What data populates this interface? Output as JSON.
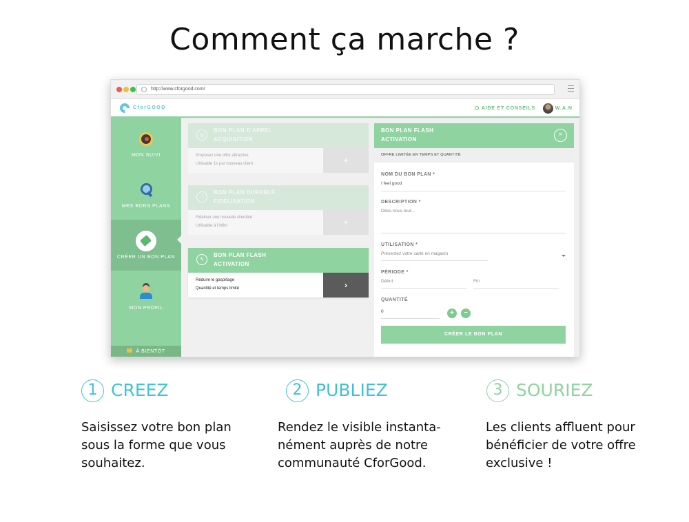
{
  "page": {
    "title": "Comment ça marche ?"
  },
  "browser": {
    "url": "http://www.cforgood.com/"
  },
  "app": {
    "logo_text": "CforGOOD",
    "help_label": "AIDE ET CONSEILS",
    "user_name": "W.A.N"
  },
  "sidebar": {
    "items": [
      {
        "label": "MON SUIVI",
        "icon": "gauge-icon"
      },
      {
        "label": "MES BONS PLANS",
        "icon": "search-icon"
      },
      {
        "label": "CRÉER UN BON PLAN",
        "icon": "tag-icon"
      },
      {
        "label": "MON PROFIL",
        "icon": "user-icon"
      }
    ],
    "footer": "À BIENTÔT"
  },
  "cards": [
    {
      "title": "BON PLAN D'APPEL",
      "subtitle": "ACQUISITION",
      "line1": "Proposez une offre attractive",
      "line2": "Utilisable 1x par nouveau client",
      "button": "+"
    },
    {
      "title": "BON PLAN DURABLE",
      "subtitle": "FIDÉLISATION",
      "line1": "Fidéliser une nouvelle clientèle",
      "line2": "Utilisable à l'infini",
      "button": "+"
    },
    {
      "title": "BON PLAN FLASH",
      "subtitle": "ACTIVATION",
      "line1": "Réduire le gaspillage",
      "line2": "Quantité et temps limité",
      "button": "›"
    }
  ],
  "panel": {
    "title": "BON PLAN FLASH",
    "subtitle": "ACTIVATION",
    "close": "×",
    "note": "OFFRE LIMITÉE EN TEMPS ET QUANTITÉ",
    "name_label": "NOM DU BON PLAN *",
    "name_value": "I feel good",
    "desc_label": "DESCRIPTION *",
    "desc_placeholder": "Dites-nous tout...",
    "usage_label": "UTILISATION *",
    "usage_value": "Présentez votre carte en magasin",
    "period_label": "PÉRIODE *",
    "period_start": "Début",
    "period_end": "Fin",
    "qty_label": "QUANTITÉ",
    "qty_value": "0",
    "plus": "+",
    "minus": "−",
    "submit": "CRÉER LE BON PLAN"
  },
  "steps": [
    {
      "num": "1",
      "title": "CREEZ",
      "color": "#3ec3d9",
      "lines": [
        "Saisissez votre bon plan",
        "sous la forme que vous",
        "souhaitez."
      ]
    },
    {
      "num": "2",
      "title": "PUBLIEZ",
      "color": "#41c0d4",
      "lines": [
        "Rendez le visible instanta-",
        "nément auprès de notre",
        "communauté CforGood."
      ]
    },
    {
      "num": "3",
      "title": "SOURIEZ",
      "color": "#8fd3a0",
      "lines": [
        "Les clients affluent pour",
        "bénéficier de votre offre",
        "exclusive !"
      ]
    }
  ]
}
